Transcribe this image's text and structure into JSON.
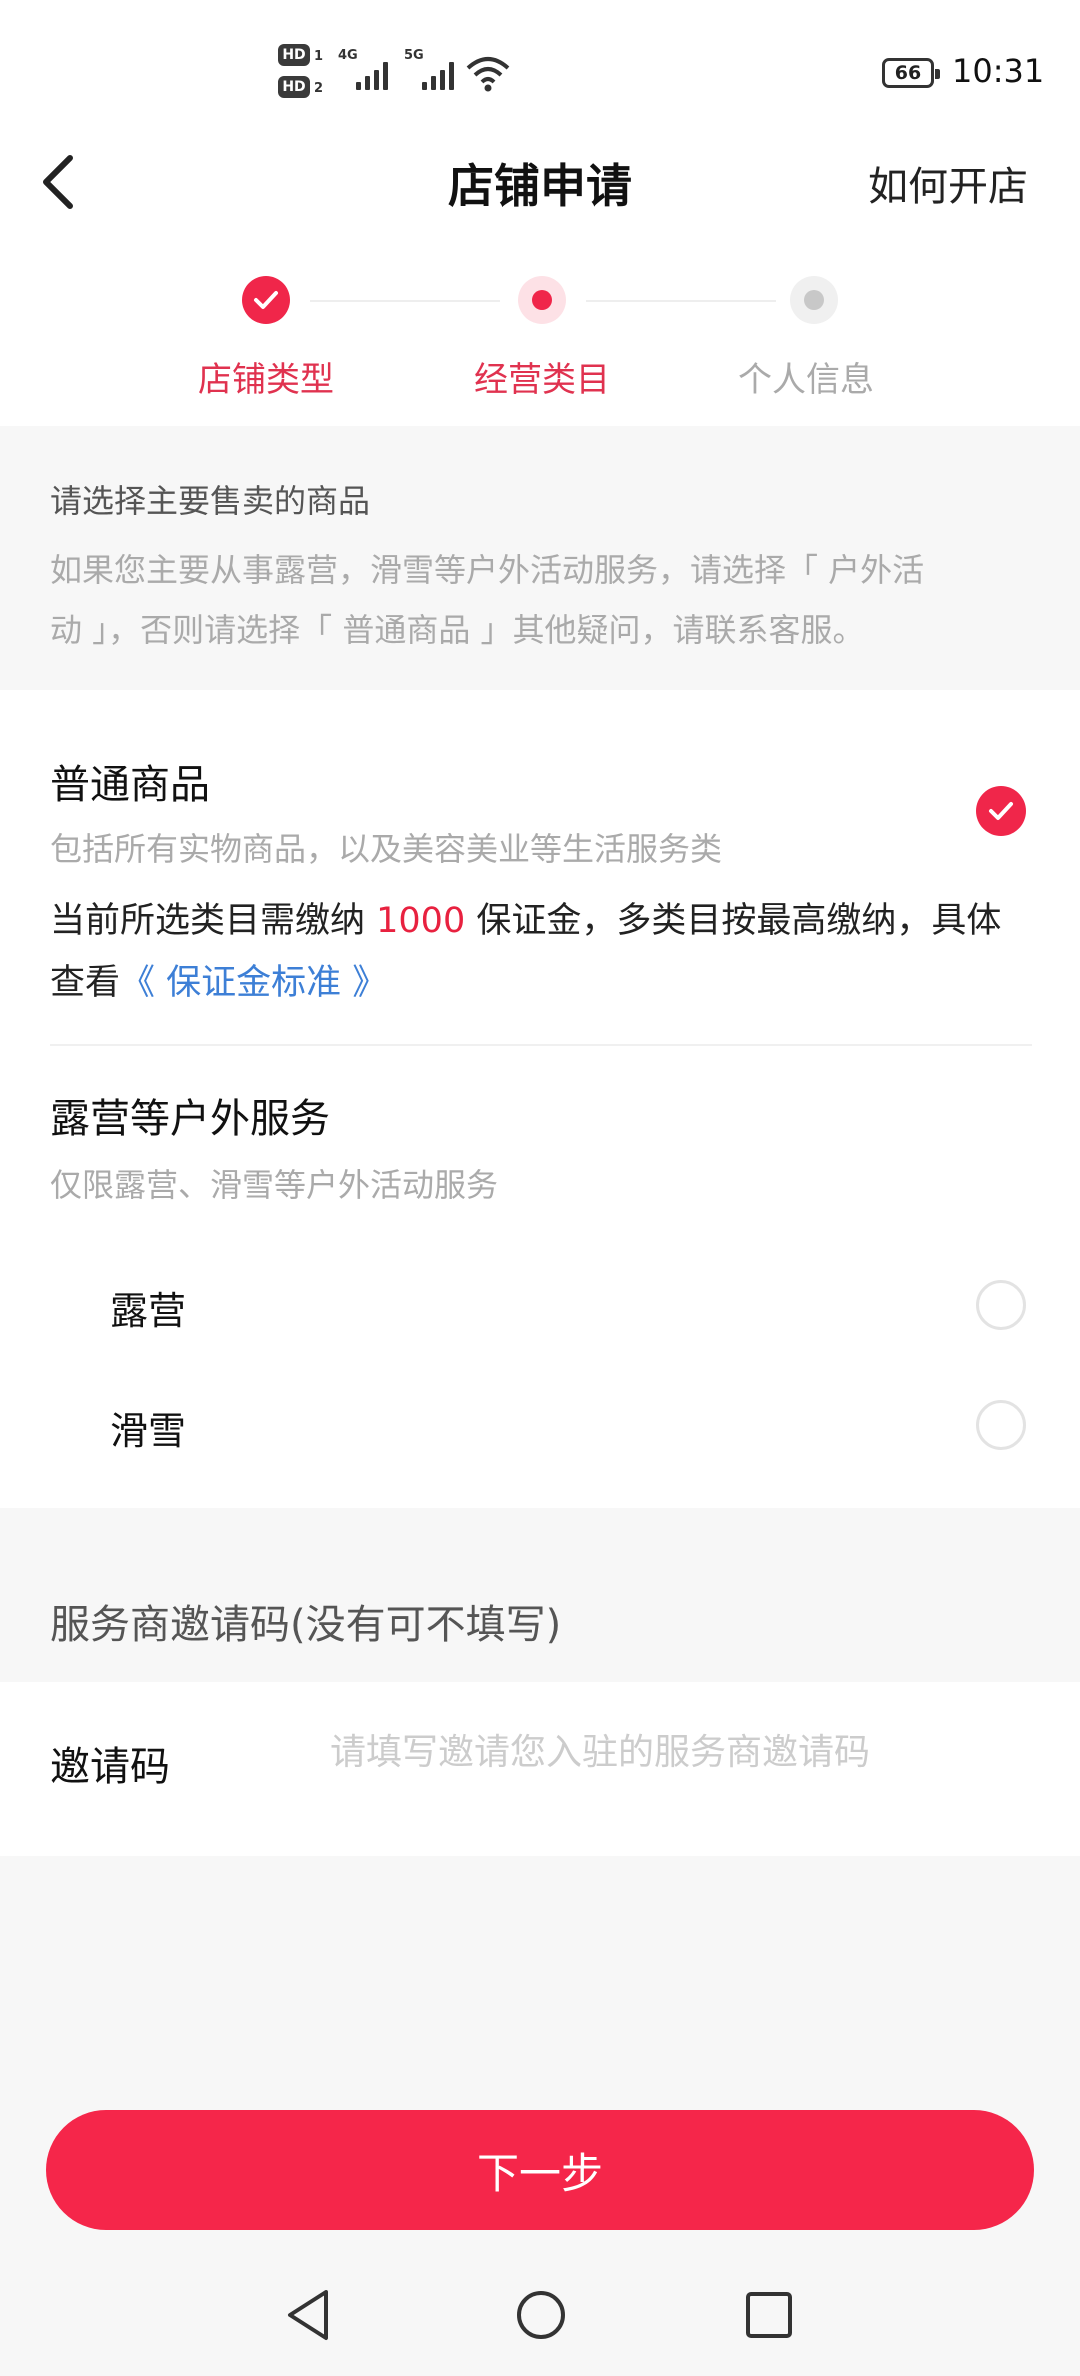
{
  "status_bar": {
    "hd1": "HD",
    "hd1_sub": "1",
    "hd2": "HD",
    "hd2_sub": "2",
    "net1": "4G",
    "net2": "5G",
    "battery": "66",
    "time": "10:31"
  },
  "header": {
    "title": "店铺申请",
    "help_link": "如何开店",
    "back_icon": "chevron-left-icon"
  },
  "stepper": {
    "steps": [
      {
        "label": "店铺类型",
        "state": "done"
      },
      {
        "label": "经营类目",
        "state": "current"
      },
      {
        "label": "个人信息",
        "state": "todo"
      }
    ],
    "active_color": "#f0264a",
    "inactive_color": "#aaaaaa"
  },
  "notice": {
    "title": "请选择主要售卖的商品",
    "text_line1": "如果您主要从事露营，滑雪等户外活动服务，请选择「 户外活",
    "text_line2": "动 」，否则请选择「 普通商品 」其他疑问，请联系客服。"
  },
  "options": {
    "general": {
      "title": "普通商品",
      "desc": "包括所有实物商品，以及美容美业等生活服务类",
      "checked": true,
      "fee_prefix": "当前所选类目需缴纳 ",
      "fee_amount": "1000",
      "fee_suffix": " 保证金，多类目按最高缴纳，具体",
      "fee_line2_prefix": "查看",
      "fee_link": "《 保证金标准 》"
    },
    "outdoor": {
      "title": "露营等户外服务",
      "desc": "仅限露营、滑雪等户外活动服务",
      "sub_options": [
        {
          "label": "露营",
          "checked": false
        },
        {
          "label": "滑雪",
          "checked": false
        }
      ]
    }
  },
  "invite": {
    "section_title": "服务商邀请码(没有可不填写)",
    "label": "邀请码",
    "value": "",
    "placeholder": "请填写邀请您入驻的服务商邀请码"
  },
  "footer": {
    "next_button": "下一步",
    "accent_color": "#f5264a"
  },
  "nav_bar": {
    "icons": [
      "back-triangle-icon",
      "home-circle-icon",
      "recents-square-icon"
    ]
  }
}
